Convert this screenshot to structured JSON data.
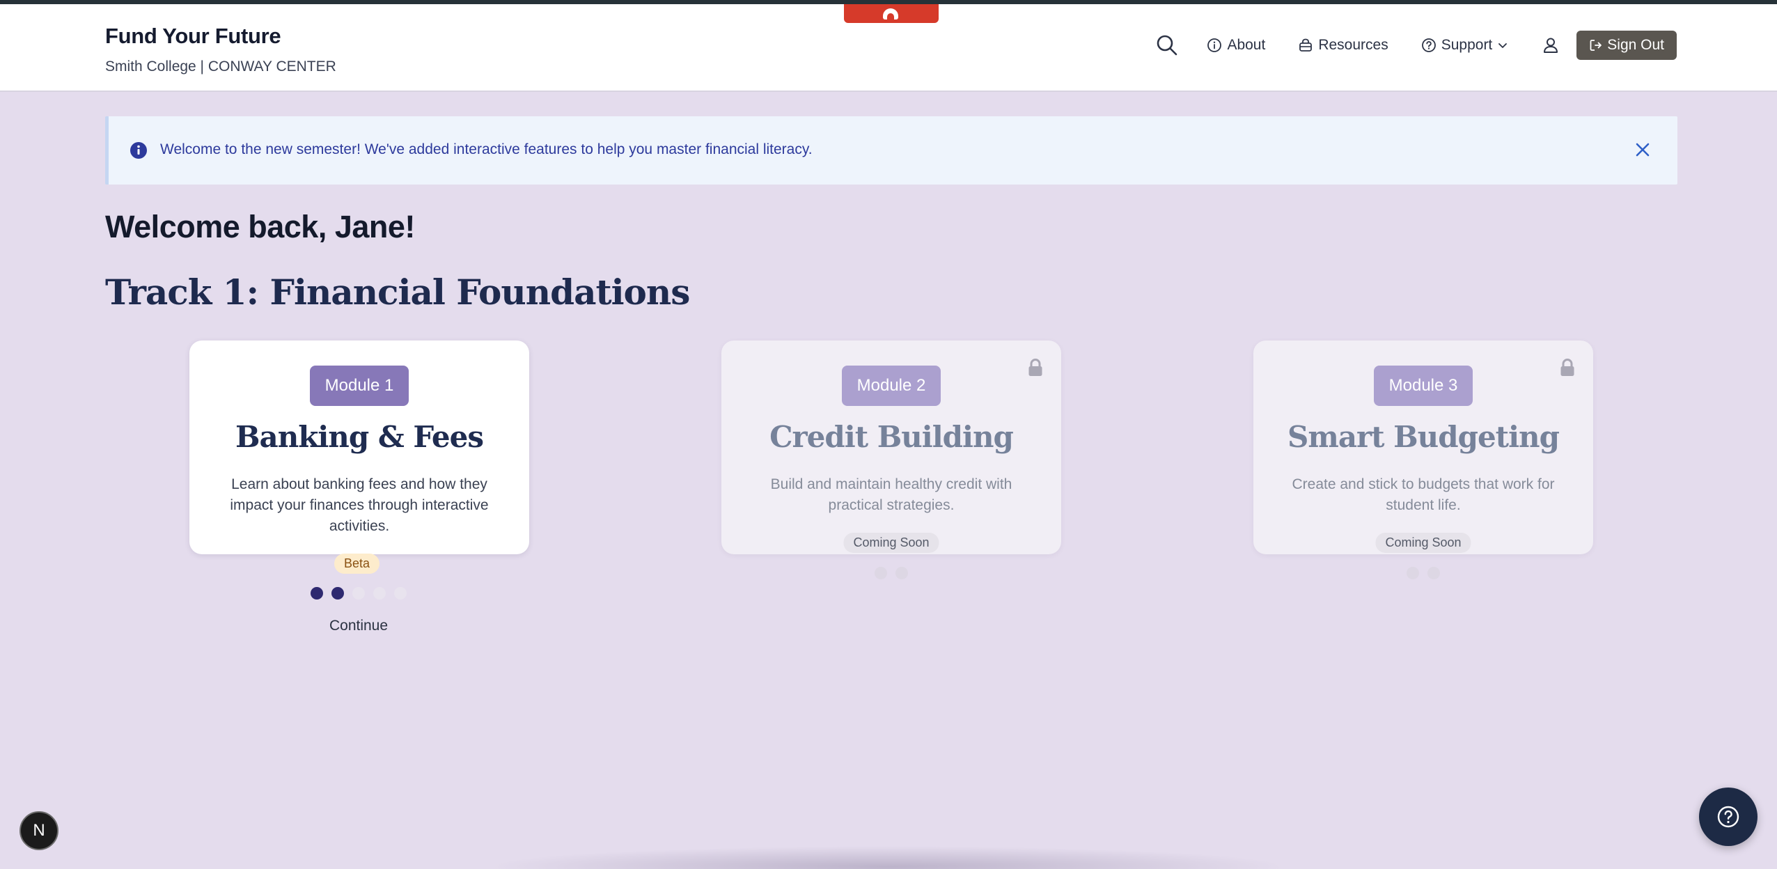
{
  "header": {
    "title": "Fund Your Future",
    "subtitle": "Smith College | CONWAY CENTER",
    "nav": {
      "about": "About",
      "resources": "Resources",
      "support": "Support",
      "sign_out": "Sign Out"
    }
  },
  "alert": {
    "message": "Welcome to the new semester! We've added interactive features to help you master financial literacy."
  },
  "main": {
    "welcome": "Welcome back, Jane!",
    "track_title": "Track 1: Financial Foundations",
    "modules": [
      {
        "badge": "Module 1",
        "title": "Banking & Fees",
        "description": "Learn about banking fees and how they impact your finances through interactive activities.",
        "locked": false,
        "tag": "Beta",
        "progress_completed": 2,
        "progress_total": 5,
        "action": "Continue"
      },
      {
        "badge": "Module 2",
        "title": "Credit Building",
        "description": "Build and maintain healthy credit with practical strategies.",
        "locked": true,
        "status": "Coming Soon"
      },
      {
        "badge": "Module 3",
        "title": "Smart Budgeting",
        "description": "Create and stick to budgets that work for student life.",
        "locked": true,
        "status": "Coming Soon"
      }
    ]
  },
  "floating": {
    "dev_badge": "N"
  },
  "colors": {
    "page_bg": "#e4dced",
    "module_badge": "#8778b8",
    "sign_out_bg": "#5a5650",
    "alert_text": "#2d3a9c",
    "progress_done": "#2e2970",
    "help_fab": "#1d2a45"
  },
  "icons": [
    "search-icon",
    "info-icon",
    "lock-bag-icon",
    "help-circle-icon",
    "chevron-down-icon",
    "user-icon",
    "logout-icon",
    "close-icon",
    "lock-icon",
    "question-icon"
  ]
}
